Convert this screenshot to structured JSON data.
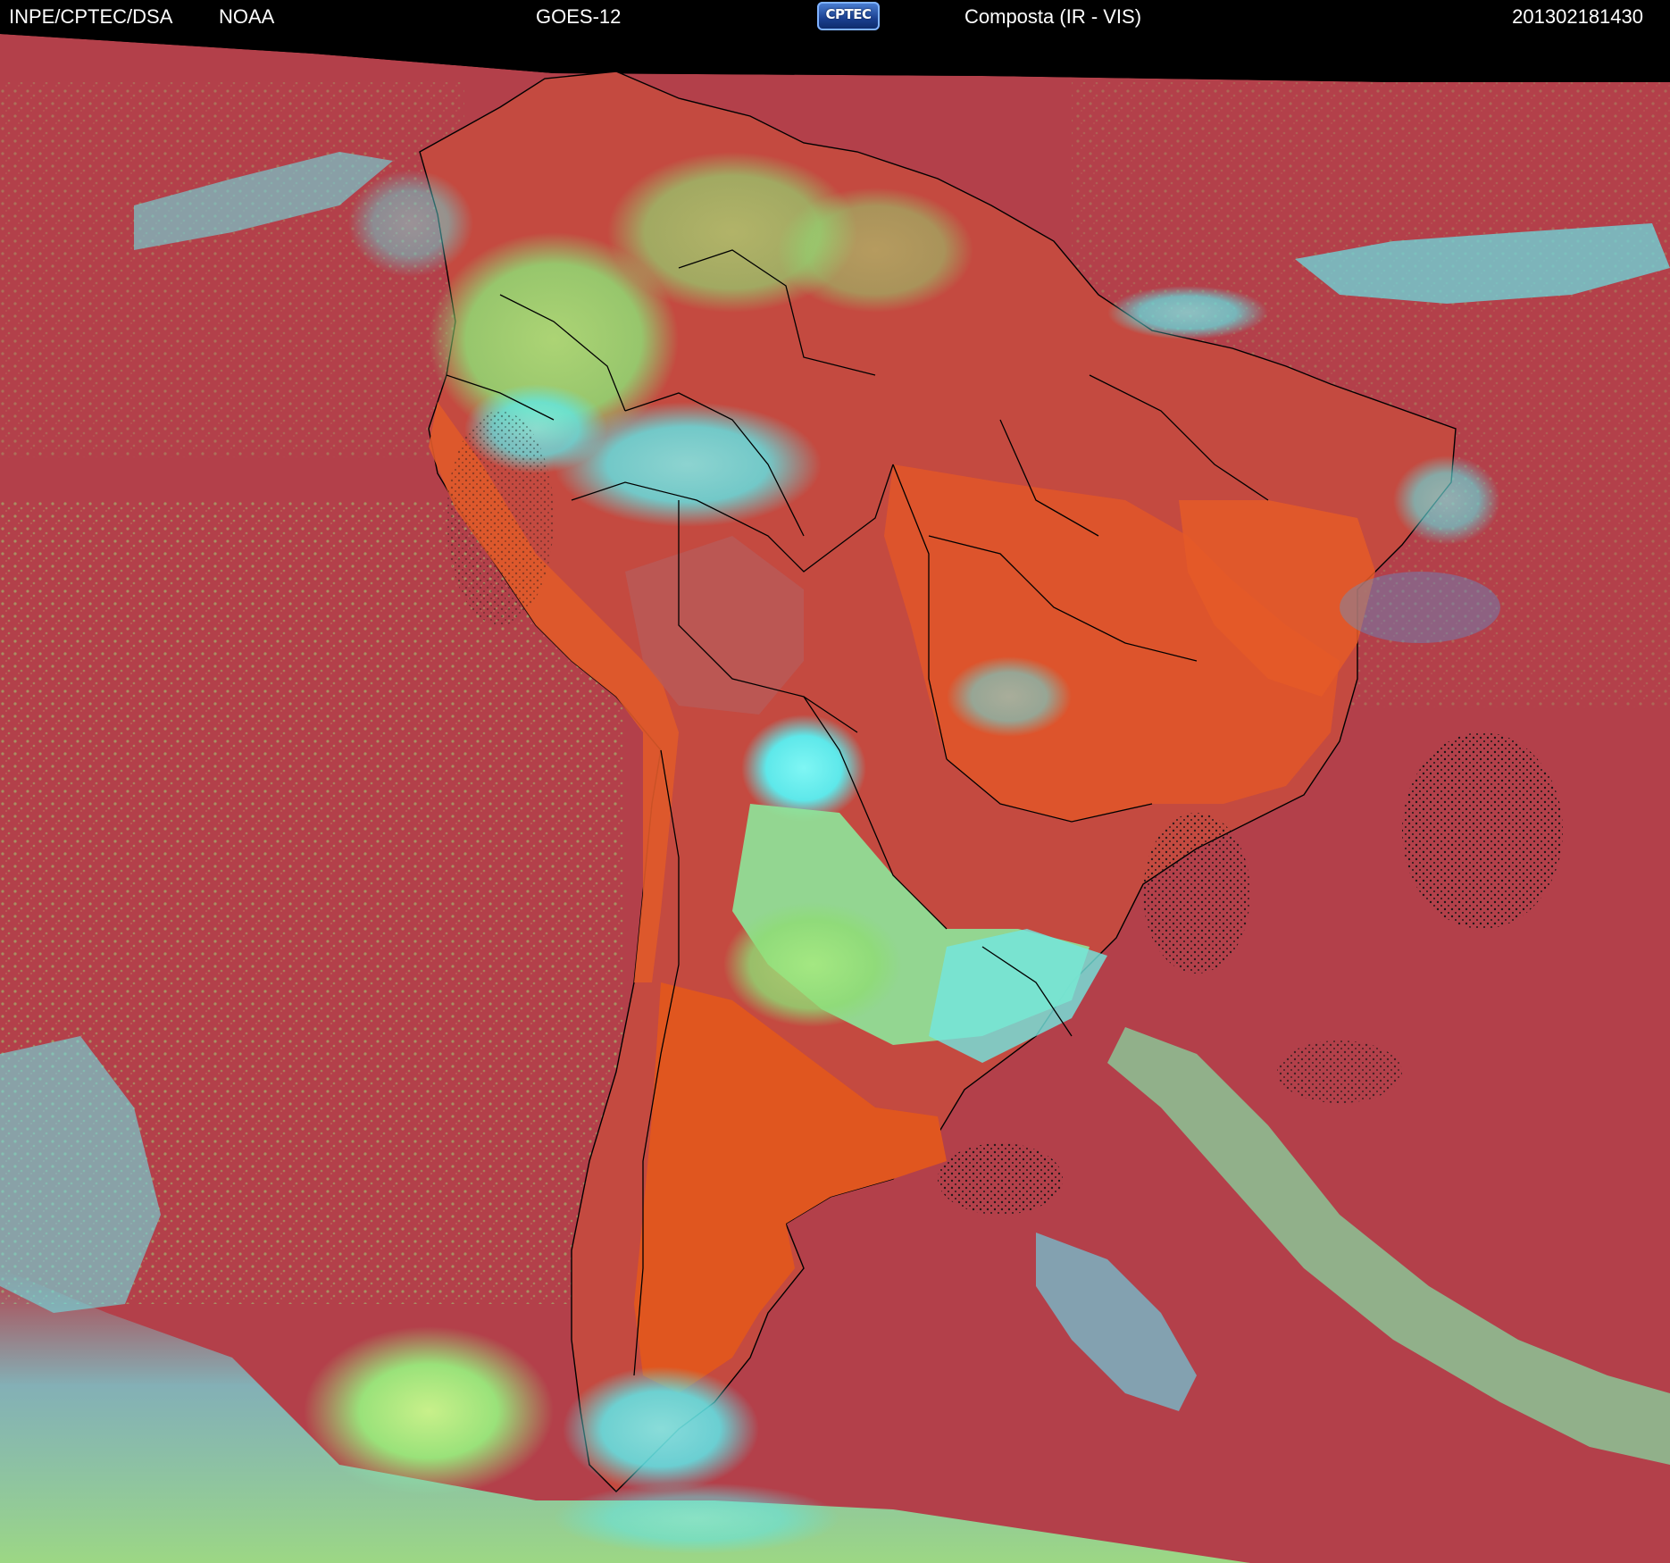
{
  "header": {
    "org": "INPE/CPTEC/DSA",
    "agency": "NOAA",
    "satellite": "GOES-12",
    "product": "Composta (IR - VIS)",
    "timestamp": "201302181430",
    "logo_text": "CPTEC"
  },
  "colors": {
    "ocean_clear": "#b3404a",
    "land_clear": "#e0552a",
    "land_dark": "#b94a3a",
    "low_cloud_green": "#8fe07a",
    "high_cloud_cyan": "#5ef0f0",
    "cold_cloud_blue": "#4aa0e8",
    "cloud_shadow_black": "#1a1a1a",
    "border_lines": "#000000"
  }
}
